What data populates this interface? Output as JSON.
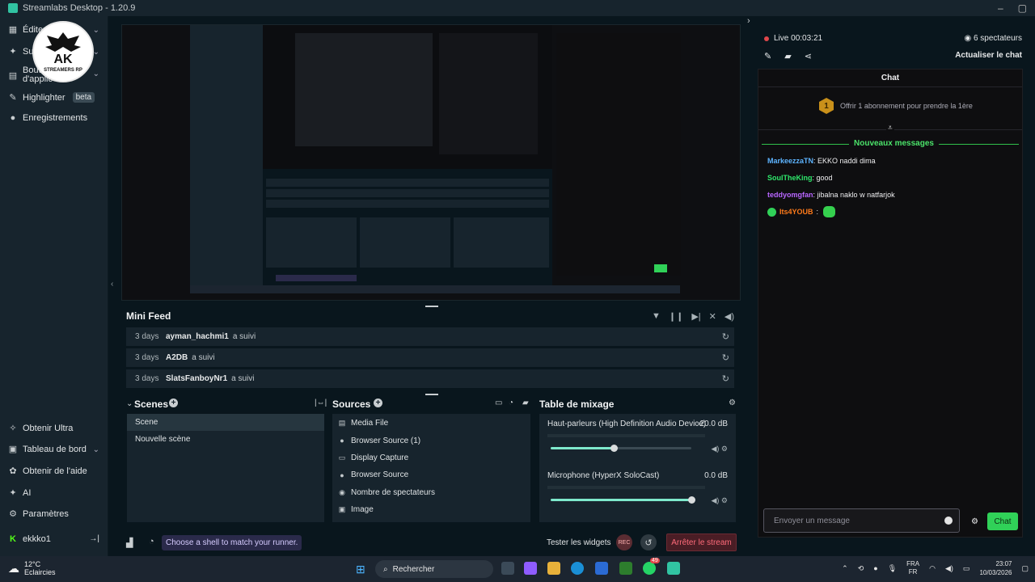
{
  "window": {
    "title": "Streamlabs Desktop - 1.20.9"
  },
  "sidebar": {
    "top_items": [
      {
        "label": "Éditeur",
        "icon": "editor-icon",
        "has_chevron": true
      },
      {
        "label": "Sup",
        "icon": "support-icon",
        "has_chevron": true
      },
      {
        "label": "Bout d'applic",
        "icon": "app-store-icon",
        "has_chevron": true
      },
      {
        "label": "Highlighter",
        "icon": "highlighter-icon",
        "badge": "beta"
      },
      {
        "label": "Enregistrements",
        "icon": "recordings-icon"
      }
    ],
    "bottom_items": [
      {
        "label": "Obtenir Ultra",
        "icon": "ultra-icon"
      },
      {
        "label": "Tableau de bord",
        "icon": "dashboard-icon",
        "has_chevron": true
      },
      {
        "label": "Obtenir de l'aide",
        "icon": "help-icon"
      },
      {
        "label": "AI",
        "icon": "ai-icon"
      },
      {
        "label": "Paramètres",
        "icon": "settings-icon"
      }
    ],
    "user": {
      "name": "ekkko1",
      "icon": "kick-icon"
    }
  },
  "logo": {
    "text": "AK",
    "subtext": "STREAMERS RP"
  },
  "mini_feed": {
    "title": "Mini Feed",
    "rows": [
      {
        "time": "3 days",
        "user": "ayman_hachmi1",
        "action": "a suivi"
      },
      {
        "time": "3 days",
        "user": "A2DB",
        "action": "a suivi"
      },
      {
        "time": "3 days",
        "user": "SlatsFanboyNr1",
        "action": "a suivi"
      }
    ]
  },
  "scenes": {
    "title": "Scenes",
    "items": [
      "Scene",
      "Nouvelle scène"
    ],
    "active_index": 0
  },
  "sources": {
    "title": "Sources",
    "items": [
      {
        "label": "Media File",
        "icon": "media-file-icon"
      },
      {
        "label": "Browser Source (1)",
        "icon": "globe-icon"
      },
      {
        "label": "Display Capture",
        "icon": "monitor-icon"
      },
      {
        "label": "Browser Source",
        "icon": "globe-icon"
      },
      {
        "label": "Nombre de spectateurs",
        "icon": "eye-icon"
      },
      {
        "label": "Image",
        "icon": "image-icon"
      }
    ]
  },
  "mixer": {
    "title": "Table de mixage",
    "channels": [
      {
        "name": "Haut-parleurs (High Definition Audio Device)",
        "db": "-20.0 dB",
        "volume": 0.45
      },
      {
        "name": "Microphone (HyperX SoloCast)",
        "db": "0.0 dB",
        "volume": 1.0
      }
    ]
  },
  "bottom_bar": {
    "hint": "Choose a shell to match your runner.",
    "test_widgets": "Tester les widgets",
    "rec_label": "REC",
    "stop_stream": "Arrêter le stream"
  },
  "live": {
    "status": "Live",
    "timer": "00:03:21",
    "viewers": "6 spectateurs",
    "refresh_chat": "Actualiser le chat"
  },
  "chat": {
    "title": "Chat",
    "gift_text": "Offrir 1 abonnement pour prendre la 1ère",
    "gift_badge": "1",
    "new_messages": "Nouveaux messages",
    "messages": [
      {
        "user": "MarkeezzaTN",
        "color": "#5db4ff",
        "text": "EKKO naddi dima"
      },
      {
        "user": "SoulTheKing",
        "color": "#2ee86b",
        "text": "good"
      },
      {
        "user": "teddyomgfan",
        "color": "#b866ff",
        "text": "jibalna naklo w natfarjok"
      },
      {
        "user": "Its4YOUB",
        "color": "#ff7a1a",
        "text": ""
      }
    ],
    "input_placeholder": "Envoyer un message",
    "send_label": "Chat"
  },
  "taskbar": {
    "weather_temp": "12°C",
    "weather_desc": "Eclaircies",
    "search": "Rechercher",
    "lang_top": "FRA",
    "lang_bottom": "FR",
    "time": "23:07",
    "date": "10/03/2026",
    "notif_badge": "49"
  },
  "colors": {
    "accent": "#31c3a2",
    "chat_green": "#30d158",
    "stop_red": "#ff6b7a"
  }
}
